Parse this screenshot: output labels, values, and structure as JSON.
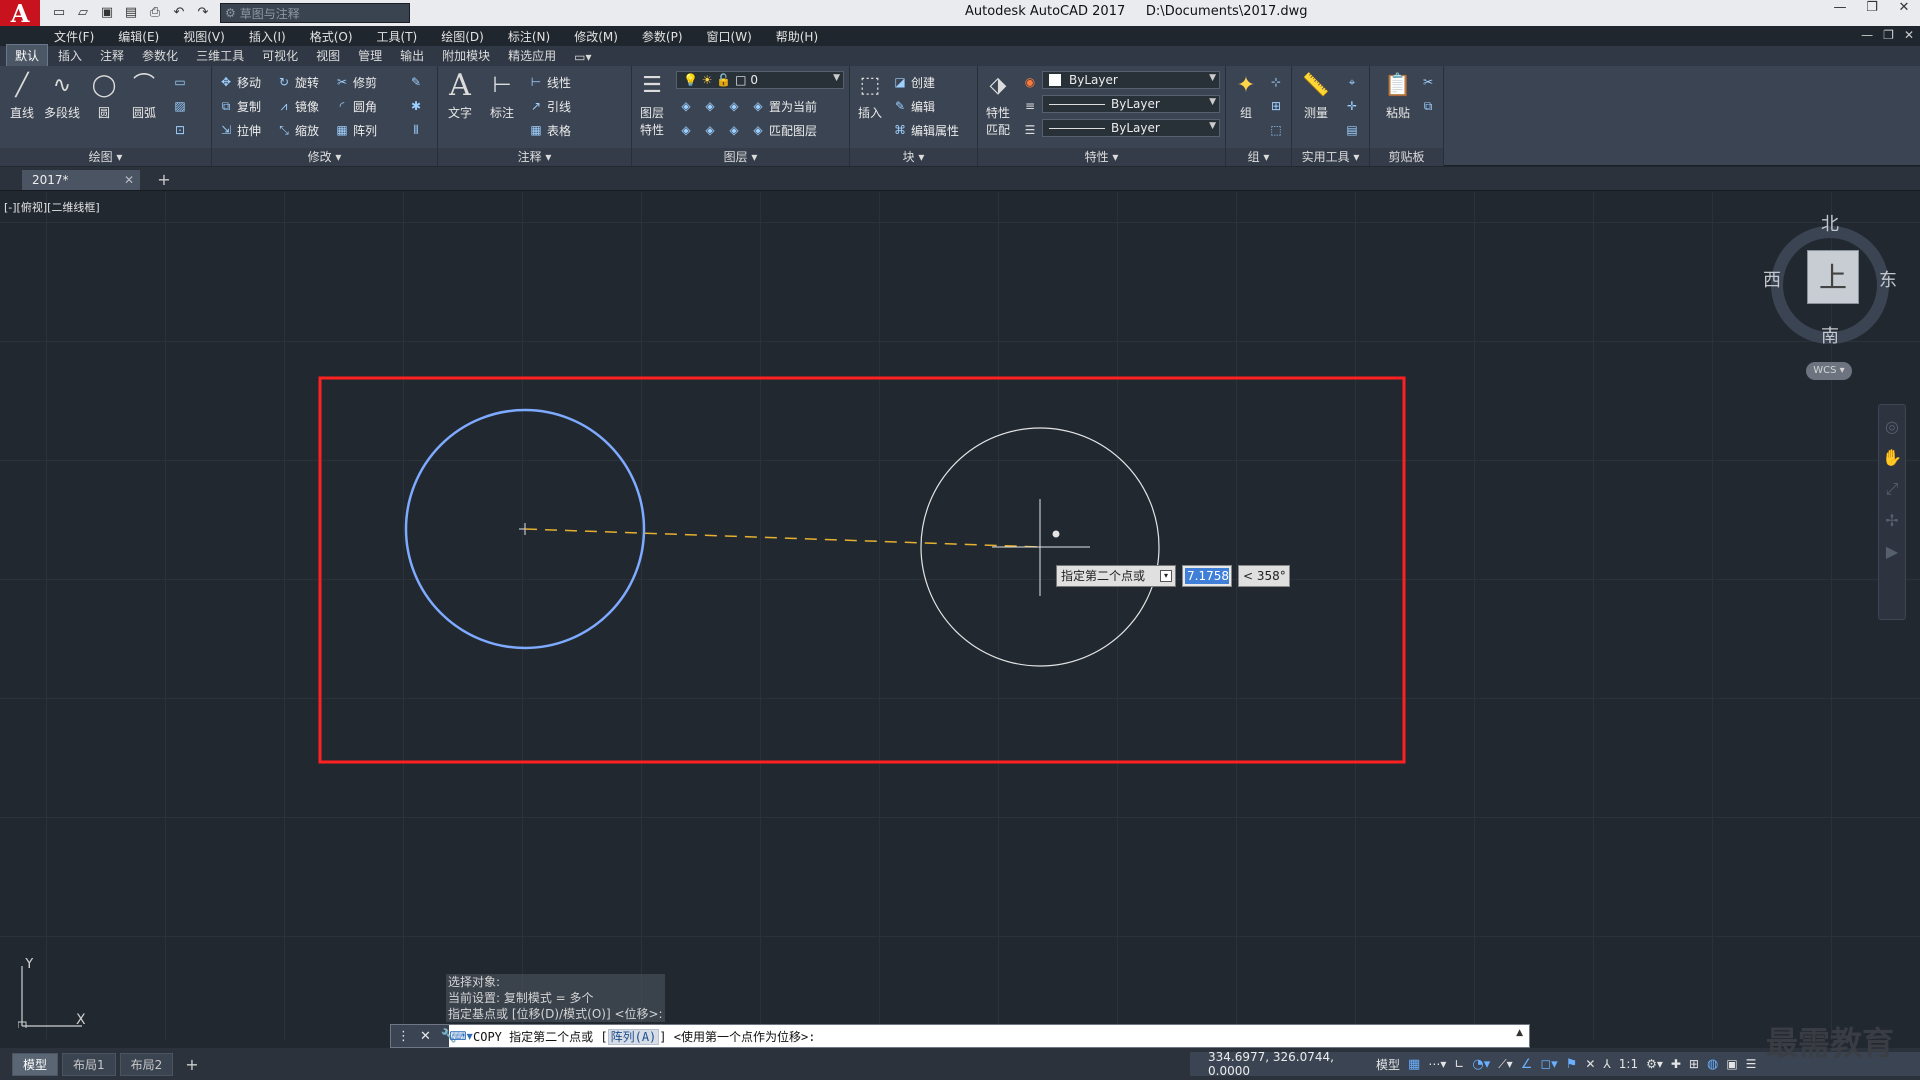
{
  "title": {
    "app": "Autodesk AutoCAD 2017",
    "file": "D:\\Documents\\2017.dwg",
    "workspace": "草图与注释"
  },
  "menu": [
    "文件(F)",
    "编辑(E)",
    "视图(V)",
    "插入(I)",
    "格式(O)",
    "工具(T)",
    "绘图(D)",
    "标注(N)",
    "修改(M)",
    "参数(P)",
    "窗口(W)",
    "帮助(H)"
  ],
  "ribbon_tabs": [
    "默认",
    "插入",
    "注释",
    "参数化",
    "三维工具",
    "可视化",
    "视图",
    "管理",
    "输出",
    "附加模块",
    "精选应用"
  ],
  "ribbon": {
    "draw": {
      "title": "绘图",
      "line": "直线",
      "polyline": "多段线",
      "circle": "圆",
      "arc": "圆弧"
    },
    "modify": {
      "title": "修改",
      "move": "移动",
      "rotate": "旋转",
      "trim": "修剪",
      "copy": "复制",
      "mirror": "镜像",
      "fillet": "圆角",
      "stretch": "拉伸",
      "scale": "缩放",
      "array": "阵列"
    },
    "annotation": {
      "title": "注释",
      "text": "文字",
      "dimension": "标注",
      "linear": "线性",
      "leader": "引线",
      "table": "表格"
    },
    "layers": {
      "title": "图层",
      "layer_props_1": "图层",
      "layer_props_2": "特性",
      "current_layer": "0",
      "set_current": "置为当前",
      "match_layer": "匹配图层"
    },
    "block": {
      "title": "块",
      "insert": "插入",
      "create": "创建",
      "edit": "编辑",
      "edit_attr": "编辑属性"
    },
    "properties": {
      "title": "特性",
      "match_1": "特性",
      "match_2": "匹配",
      "color": "ByLayer",
      "linetype": "ByLayer",
      "lineweight": "ByLayer"
    },
    "groups": {
      "title": "组",
      "group": "组"
    },
    "utilities": {
      "title": "实用工具",
      "measure": "测量"
    },
    "clipboard": {
      "title": "剪贴板",
      "paste": "粘贴"
    }
  },
  "doc_tab": "2017*",
  "view_label": "[-][俯视][二维线框]",
  "viewcube": {
    "north": "北",
    "south": "南",
    "east": "东",
    "west": "西",
    "face": "上",
    "wcs": "WCS"
  },
  "dynamic_input": {
    "prompt": "指定第二个点或",
    "distance": "7.1758",
    "angle": "< 358°"
  },
  "ucs": {
    "x": "X",
    "y": "Y"
  },
  "command_history": [
    "选择对象:",
    "当前设置:  复制模式 = 多个",
    "指定基点或 [位移(D)/模式(O)] <位移>:"
  ],
  "command_line": {
    "cmd": "COPY",
    "prompt": "指定第二个点或",
    "option": "阵列(A)",
    "rest": "<使用第一个点作为位移>:"
  },
  "layout_tabs": [
    "模型",
    "布局1",
    "布局2"
  ],
  "status": {
    "coords": "334.6977, 326.0744, 0.0000",
    "mode": "模型",
    "scale": "1:1"
  },
  "watermark": "最需教育",
  "colors": {
    "canvas": "#212830",
    "selected_circle": "#7eaaff",
    "circle": "#e4e4e4",
    "rubberband": "#e6b030",
    "highlight_box": "#ff2020"
  }
}
